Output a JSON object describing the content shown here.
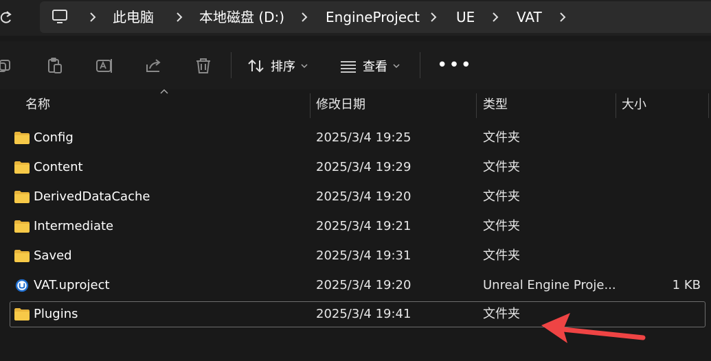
{
  "address_bar": {
    "crumbs": [
      "此电脑",
      "本地磁盘 (D:)",
      "EngineProject",
      "UE",
      "VAT"
    ]
  },
  "toolbar": {
    "sort_label": "排序",
    "view_label": "查看",
    "more_label": "•••"
  },
  "columns": {
    "name": "名称",
    "modified": "修改日期",
    "type": "类型",
    "size": "大小"
  },
  "rows": [
    {
      "name": "Config",
      "modified": "2025/3/4 19:25",
      "type": "文件夹",
      "size": "",
      "icon": "folder-icon"
    },
    {
      "name": "Content",
      "modified": "2025/3/4 19:29",
      "type": "文件夹",
      "size": "",
      "icon": "folder-icon"
    },
    {
      "name": "DerivedDataCache",
      "modified": "2025/3/4 19:20",
      "type": "文件夹",
      "size": "",
      "icon": "folder-icon"
    },
    {
      "name": "Intermediate",
      "modified": "2025/3/4 19:21",
      "type": "文件夹",
      "size": "",
      "icon": "folder-icon"
    },
    {
      "name": "Saved",
      "modified": "2025/3/4 19:31",
      "type": "文件夹",
      "size": "",
      "icon": "folder-icon"
    },
    {
      "name": "VAT.uproject",
      "modified": "2025/3/4 19:20",
      "type": "Unreal Engine Proje...",
      "size": "1 KB",
      "icon": "unreal-engine-icon"
    },
    {
      "name": "Plugins",
      "modified": "2025/3/4 19:41",
      "type": "文件夹",
      "size": "",
      "icon": "folder-icon",
      "selected": true
    }
  ],
  "colors": {
    "background": "#191919",
    "folder_yellow": "#f7c948",
    "annotation_arrow": "#ef4444"
  }
}
